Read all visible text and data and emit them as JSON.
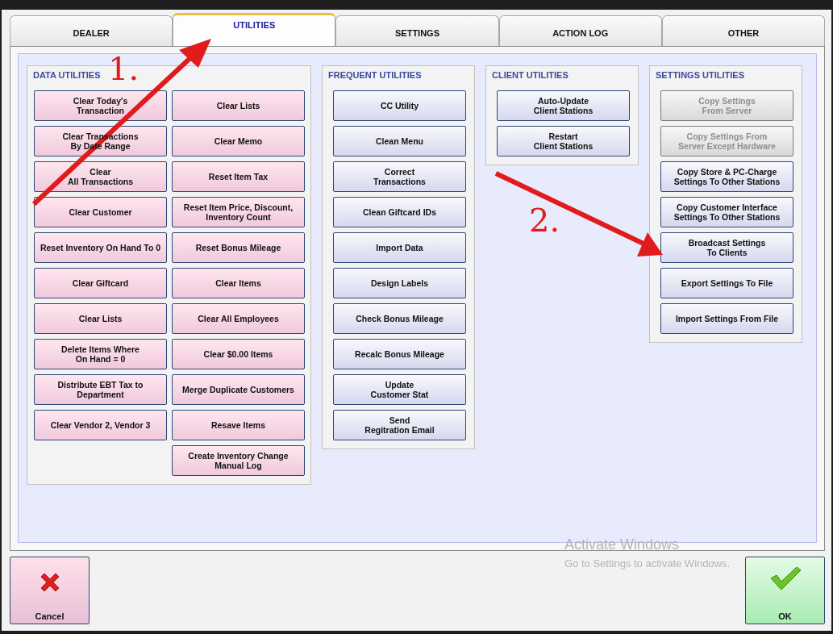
{
  "tabs": [
    {
      "label": "DEALER",
      "selected": false
    },
    {
      "label": "UTILITIES",
      "selected": true
    },
    {
      "label": "SETTINGS",
      "selected": false
    },
    {
      "label": "ACTION LOG",
      "selected": false
    },
    {
      "label": "OTHER",
      "selected": false
    }
  ],
  "groups": [
    {
      "title": "DATA UTILITIES",
      "kind": "grid",
      "columns": [
        [
          {
            "label": "Clear Today's\nTransaction",
            "disabled": false
          },
          {
            "label": "Clear Transactions\nBy Date Range",
            "disabled": false
          },
          {
            "label": "Clear\nAll Transactions",
            "disabled": false
          },
          {
            "label": "Clear Customer",
            "disabled": false
          },
          {
            "label": "Reset Inventory On Hand To 0",
            "disabled": false
          },
          {
            "label": "Clear Giftcard",
            "disabled": false
          },
          {
            "label": "Clear Lists",
            "disabled": false
          },
          {
            "label": "Delete Items Where\nOn Hand = 0",
            "disabled": false
          },
          {
            "label": "Distribute EBT Tax to\nDepartment",
            "disabled": false
          },
          {
            "label": "Clear Vendor 2, Vendor 3",
            "disabled": false
          }
        ],
        [
          {
            "label": "Clear Lists",
            "disabled": false
          },
          {
            "label": "Clear Memo",
            "disabled": false
          },
          {
            "label": "Reset Item Tax",
            "disabled": false
          },
          {
            "label": "Reset Item Price, Discount,\nInventory Count",
            "disabled": false
          },
          {
            "label": "Reset Bonus Mileage",
            "disabled": false
          },
          {
            "label": "Clear Items",
            "disabled": false
          },
          {
            "label": "Clear All Employees",
            "disabled": false
          },
          {
            "label": "Clear $0.00 Items",
            "disabled": false
          },
          {
            "label": "Merge Duplicate Customers",
            "disabled": false
          },
          {
            "label": "Resave Items",
            "disabled": false
          },
          {
            "label": "Create Inventory Change\nManual Log",
            "disabled": false
          }
        ]
      ]
    },
    {
      "title": "FREQUENT UTILITIES",
      "kind": "list",
      "buttons": [
        {
          "label": "CC Utility",
          "disabled": false
        },
        {
          "label": "Clean Menu",
          "disabled": false
        },
        {
          "label": "Correct\nTransactions",
          "disabled": false
        },
        {
          "label": "Clean Giftcard IDs",
          "disabled": false
        },
        {
          "label": "Import Data",
          "disabled": false
        },
        {
          "label": "Design Labels",
          "disabled": false
        },
        {
          "label": "Check Bonus Mileage",
          "disabled": false
        },
        {
          "label": "Recalc Bonus Mileage",
          "disabled": false
        },
        {
          "label": "Update\nCustomer Stat",
          "disabled": false
        },
        {
          "label": "Send\nRegitration Email",
          "disabled": false
        }
      ]
    },
    {
      "title": "CLIENT UTILITIES",
      "kind": "list",
      "buttons": [
        {
          "label": "Auto-Update\nClient Stations",
          "disabled": false
        },
        {
          "label": "Restart\nClient Stations",
          "disabled": false
        }
      ]
    },
    {
      "title": "SETTINGS UTILITIES",
      "kind": "list",
      "buttons": [
        {
          "label": "Copy Settings\nFrom Server",
          "disabled": true
        },
        {
          "label": "Copy Settings From\nServer Except Hardware",
          "disabled": true
        },
        {
          "label": "Copy Store & PC-Charge\nSettings To Other Stations",
          "disabled": false
        },
        {
          "label": "Copy Customer Interface\nSettings To Other Stations",
          "disabled": false
        },
        {
          "label": "Broadcast Settings\nTo Clients",
          "disabled": false
        },
        {
          "label": "Export Settings To File",
          "disabled": false
        },
        {
          "label": "Import Settings From File",
          "disabled": false
        }
      ]
    }
  ],
  "footer": {
    "cancel": "Cancel",
    "ok": "OK"
  },
  "os_notice": {
    "title": "Activate Windows",
    "message": "Go to Settings to activate Windows."
  },
  "annotations": [
    {
      "label": "1."
    },
    {
      "label": "2."
    }
  ]
}
